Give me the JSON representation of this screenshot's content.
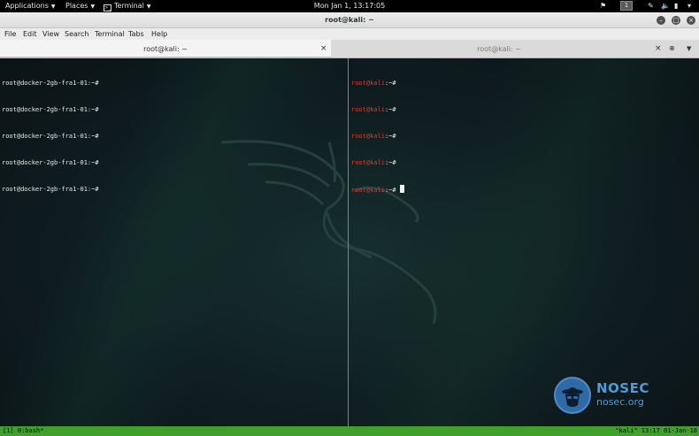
{
  "topbar": {
    "applications": "Applications",
    "places": "Places",
    "terminal": "Terminal",
    "clock": "Mon Jan  1, 13:17:05",
    "workspace": "1"
  },
  "window": {
    "title": "root@kali: ~"
  },
  "menubar": [
    "File",
    "Edit",
    "View",
    "Search",
    "Terminal",
    "Tabs",
    "Help"
  ],
  "tabs": [
    {
      "label": "root@kali: ~",
      "active": true
    },
    {
      "label": "root@kali: ~",
      "active": false
    }
  ],
  "left_pane": {
    "lines": [
      "root@docker-2gb-fra1-01:~#",
      "root@docker-2gb-fra1-01:~#",
      "root@docker-2gb-fra1-01:~#",
      "root@docker-2gb-fra1-01:~#",
      "root@docker-2gb-fra1-01:~#"
    ]
  },
  "right_pane": {
    "lines": [
      {
        "user": "root@kali",
        "rest": ":~#"
      },
      {
        "user": "root@kali",
        "rest": ":~#"
      },
      {
        "user": "root@kali",
        "rest": ":~#"
      },
      {
        "user": "root@kali",
        "rest": ":~#"
      },
      {
        "user": "root@kali",
        "rest": ":~#"
      }
    ]
  },
  "watermark": {
    "title": "NOSEC",
    "subtitle": "nosec.org"
  },
  "status": {
    "left": "[1] 0:bash*",
    "right": "\"kali\" 13:17 01-Jan-18"
  },
  "colors": {
    "prompt_user": "#e23a2a",
    "status_bar": "#3fa12a",
    "watermark": "#4f9ad8"
  }
}
